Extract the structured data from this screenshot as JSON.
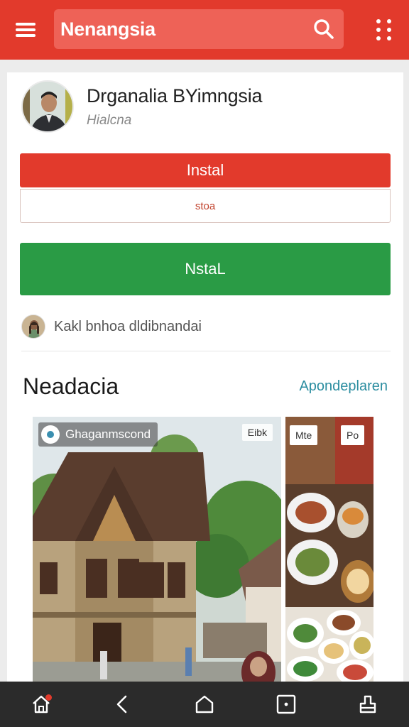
{
  "appbar": {
    "title": "Nenangsia",
    "color": "#e23a2c",
    "icons": [
      "menu-icon",
      "search-icon",
      "more-vert-icon"
    ]
  },
  "profile": {
    "name": "Drganalia BYimngsia",
    "subtitle": "Hialcna"
  },
  "buttons": {
    "primary_label": "Instal",
    "secondary_label": "stoa",
    "green_label": "NstaL",
    "red_color": "#e23a2c",
    "green_color": "#2a9b45"
  },
  "contributor": {
    "text": "Kakl bnhoa dldibnandai"
  },
  "section": {
    "title": "Neadacia",
    "link": "Apondeplaren"
  },
  "gallery": {
    "main_chip": "Ghaganmscond",
    "main_tag": "Eibk",
    "side_tags": [
      "Mte",
      "Po"
    ]
  },
  "bottom_nav": {
    "icons": [
      "home-icon",
      "back-icon",
      "house-icon",
      "square-icon",
      "share-icon"
    ]
  }
}
